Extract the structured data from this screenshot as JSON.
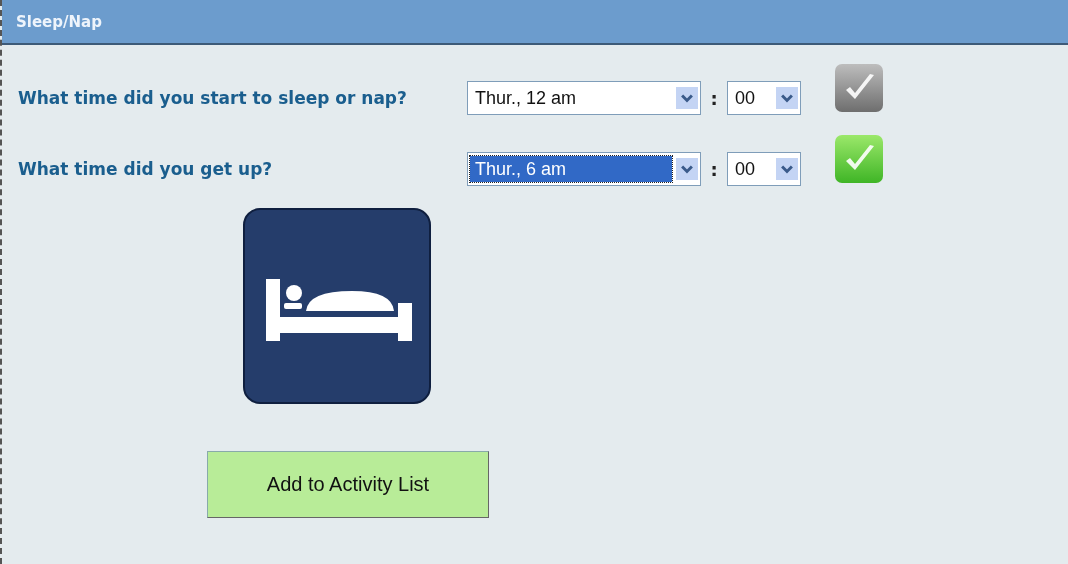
{
  "panel": {
    "title": "Sleep/Nap"
  },
  "questions": [
    {
      "label": "What time did you start to sleep or nap?",
      "hour": {
        "value": "Thur., 12 am",
        "focused": false
      },
      "separator": ":",
      "minute": {
        "value": "00"
      },
      "confirmed": false
    },
    {
      "label": "What time did you get up?",
      "hour": {
        "value": "Thur., 6 am",
        "focused": true
      },
      "separator": ":",
      "minute": {
        "value": "00"
      },
      "confirmed": true
    }
  ],
  "activity": {
    "kind": "bed"
  },
  "add_button": {
    "label": "Add to Activity List"
  }
}
